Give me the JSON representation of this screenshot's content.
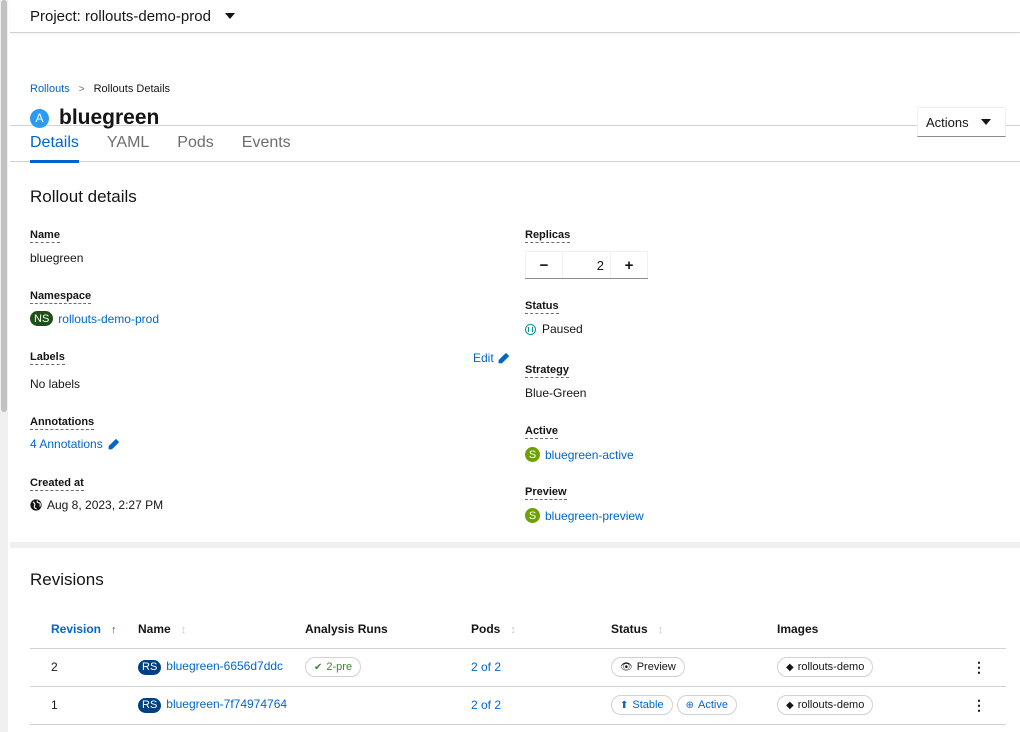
{
  "project": {
    "label": "Project: rollouts-demo-prod"
  },
  "breadcrumb": {
    "parent": "Rollouts",
    "separator": ">",
    "current": "Rollouts Details"
  },
  "title": {
    "badge": "A",
    "name": "bluegreen"
  },
  "actions_label": "Actions",
  "tabs": [
    {
      "label": "Details",
      "active": true
    },
    {
      "label": "YAML"
    },
    {
      "label": "Pods"
    },
    {
      "label": "Events"
    }
  ],
  "details": {
    "section_title": "Rollout details",
    "name_term": "Name",
    "name_value": "bluegreen",
    "namespace_term": "Namespace",
    "namespace_badge": "NS",
    "namespace_value": "rollouts-demo-prod",
    "labels_term": "Labels",
    "labels_value": "No labels",
    "edit_label": "Edit",
    "annotations_term": "Annotations",
    "annotations_value": "4 Annotations",
    "created_term": "Created at",
    "created_value": "Aug 8, 2023, 2:27 PM",
    "replicas_term": "Replicas",
    "replicas_minus": "−",
    "replicas_value": "2",
    "replicas_plus": "+",
    "status_term": "Status",
    "status_value": "Paused",
    "strategy_term": "Strategy",
    "strategy_value": "Blue-Green",
    "active_term": "Active",
    "active_badge": "S",
    "active_value": "bluegreen-active",
    "preview_term": "Preview",
    "preview_badge": "S",
    "preview_value": "bluegreen-preview"
  },
  "revisions": {
    "section_title": "Revisions",
    "headers": [
      "Revision",
      "Name",
      "Analysis Runs",
      "Pods",
      "Status",
      "Images"
    ],
    "rows": [
      {
        "revision": "2",
        "badge": "RS",
        "name": "bluegreen-6656d7ddc",
        "analysis": "2-pre",
        "pods": "2 of 2",
        "status1": "Preview",
        "status2": "",
        "image": "rollouts-demo"
      },
      {
        "revision": "1",
        "badge": "RS",
        "name": "bluegreen-7f74974764",
        "analysis": "",
        "pods": "2 of 2",
        "status1": "Stable",
        "status2": "Active",
        "image": "rollouts-demo"
      }
    ]
  },
  "colors": {
    "link": "#0066cc",
    "accent": "#2b9af3",
    "ns_badge": "#1e4f18",
    "s_badge": "#6ca100",
    "rs_badge": "#004080"
  }
}
